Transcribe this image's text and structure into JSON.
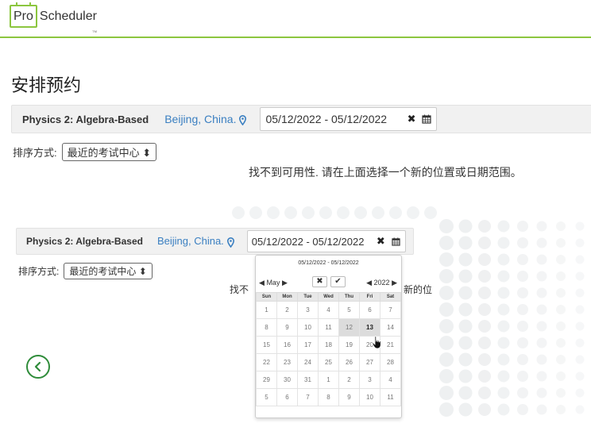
{
  "header": {
    "logo_pro": "Pro",
    "logo_scheduler": "Scheduler",
    "logo_tm": "TM"
  },
  "page_title": "安排预约",
  "search1": {
    "course": "Physics 2: Algebra-Based",
    "location": "Beijing, China.",
    "date_range": "05/12/2022 - 05/12/2022",
    "sort_label": "排序方式:",
    "sort_value": "最近的考试中心",
    "no_availability": "找不到可用性. 请在上面选择一个新的位置或日期范围。"
  },
  "search2": {
    "course": "Physics 2: Algebra-Based",
    "location": "Beijing, China.",
    "date_range": "05/12/2022 - 05/12/2022",
    "sort_label": "排序方式:",
    "sort_value": "最近的考试中心",
    "no_availability_left": "找不",
    "no_availability_right": "新的位"
  },
  "datepicker": {
    "range": "05/12/2022 - 05/12/2022",
    "month": "May",
    "year": "2022",
    "weekdays": [
      "Sun",
      "Mon",
      "Tue",
      "Wed",
      "Thu",
      "Fri",
      "Sat"
    ],
    "weeks": [
      [
        "1",
        "2",
        "3",
        "4",
        "5",
        "6",
        "7"
      ],
      [
        "8",
        "9",
        "10",
        "11",
        "12",
        "13",
        "14"
      ],
      [
        "15",
        "16",
        "17",
        "18",
        "19",
        "20",
        "21"
      ],
      [
        "22",
        "23",
        "24",
        "25",
        "26",
        "27",
        "28"
      ],
      [
        "29",
        "30",
        "31",
        "1",
        "2",
        "3",
        "4"
      ],
      [
        "5",
        "6",
        "7",
        "8",
        "9",
        "10",
        "11"
      ]
    ]
  },
  "icons": {
    "pin": "map-pin-icon",
    "clear": "clear-x-icon",
    "calendar": "calendar-icon",
    "back": "chevron-left-icon",
    "cursor": "hand-pointer-icon"
  },
  "colors": {
    "brand_green": "#8cc63f",
    "link_blue": "#3a7fc1",
    "back_green": "#2f8c3a"
  }
}
